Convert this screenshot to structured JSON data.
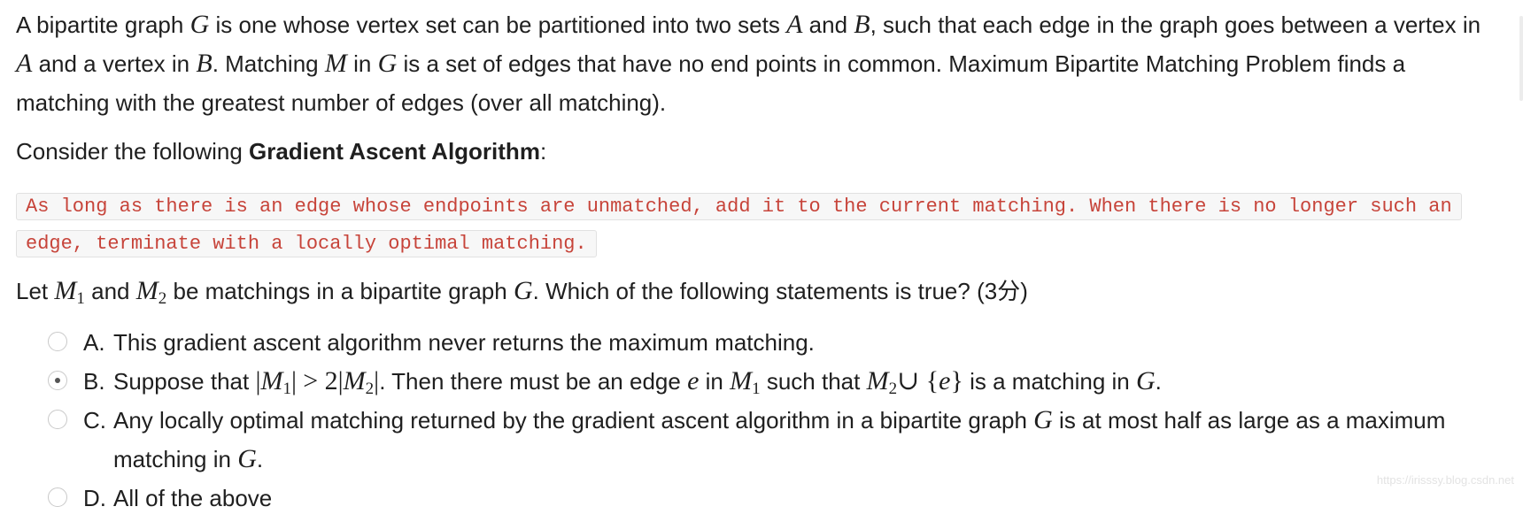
{
  "intro": {
    "p1": "A bipartite graph",
    "p2": "is one whose vertex set can be partitioned into two sets",
    "p3": "and",
    "p4": ", such that each edge in the graph goes between a vertex in",
    "p5": "and a vertex in",
    "p6": ". Matching",
    "p7": "in",
    "p8": "is a set of edges that have no end points in common. Maximum Bipartite Matching Problem finds a matching with the greatest number of edges (over all matching)."
  },
  "consider": {
    "prefix": "Consider the following",
    "bold": "Gradient Ascent Algorithm",
    "suffix": ":"
  },
  "algorithm_text": "As long as there is an edge whose endpoints are unmatched, add it to the current matching. When there is no longer such an edge, terminate with a locally optimal matching.",
  "question": {
    "q1": "Let",
    "q2": "and",
    "q3": "be matchings in a bipartite graph",
    "q4": ". Which of the following statements is true? (3分)"
  },
  "math": {
    "G": "G",
    "A": "A",
    "B": "B",
    "M": "M",
    "M1": "M",
    "M2": "M",
    "sub1": "1",
    "sub2": "2",
    "e": "e"
  },
  "options": {
    "a": {
      "letter": "A.",
      "text": "This gradient ascent algorithm never returns the maximum matching.",
      "selected": false
    },
    "b": {
      "letter": "B.",
      "t1": "Suppose that",
      "gt": "> 2",
      "t2": ". Then there must be an edge",
      "t3": "in",
      "t4": "such that",
      "cup": "∪ {",
      "close": "}",
      "t5": "is a matching in",
      "t6": ".",
      "selected": true
    },
    "c": {
      "letter": "C.",
      "t1": "Any locally optimal matching returned by the gradient ascent algorithm in a bipartite graph",
      "t2": "is at most half as large as a maximum matching in",
      "t3": ".",
      "selected": false
    },
    "d": {
      "letter": "D.",
      "text": "All of the above",
      "selected": false
    }
  },
  "watermark": "https://irisssy.blog.csdn.net"
}
